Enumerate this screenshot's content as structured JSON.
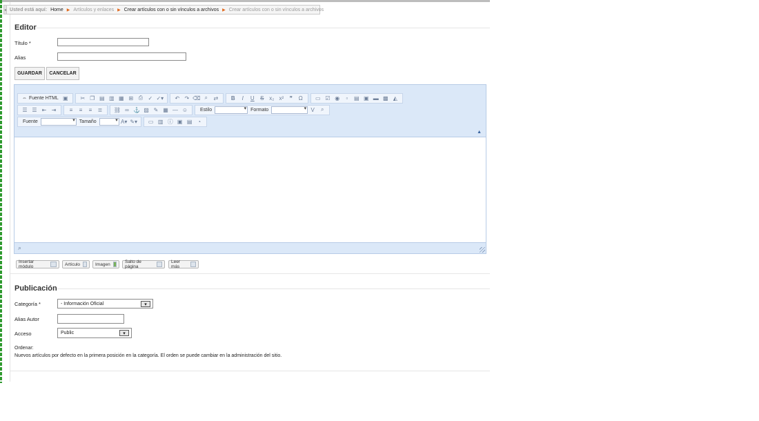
{
  "breadcrumb": {
    "prefix": "Usted está aquí:",
    "items": [
      "Home",
      "Artículos y enlaces",
      "Crear artículos con o sin vínculos a archivos",
      "Crear artículos con o sin vínculos a archivos"
    ]
  },
  "editor_section": {
    "title": "Editor",
    "titulo_label": "Título *",
    "titulo_value": "",
    "alias_label": "Alias",
    "alias_value": ""
  },
  "actions": {
    "save": "GUARDAR",
    "cancel": "CANCELAR"
  },
  "toolbar": {
    "source_html": "Fuente HTML",
    "style_label": "Estilo",
    "format_label": "Formato",
    "font_label": "Fuente",
    "size_label": "Tamaño",
    "bold": "B",
    "italic": "I",
    "underline": "U",
    "strike": "S",
    "subscript": "x₂",
    "superscript": "x²",
    "blockquote": "❞",
    "omega": "Ω"
  },
  "editor_buttons": [
    "Insertar módulo",
    "Artículo",
    "Imagen",
    "Salto de página",
    "Leer más"
  ],
  "publicacion": {
    "title": "Publicación",
    "categoria_label": "Categoría *",
    "categoria_value": "- Información Oficial",
    "alias_autor_label": "Alias Autor",
    "alias_autor_value": "",
    "acceso_label": "Acceso",
    "acceso_value": "Public",
    "ordenar_label": "Ordenar:",
    "ordenar_note": "Nuevos artículos por defecto en la primera posición en la categoría. El orden se puede cambiar en la administración del sitio."
  },
  "colors": {
    "toolbar_bg": "#dbe8f8",
    "accent_orange": "#e0691c"
  }
}
